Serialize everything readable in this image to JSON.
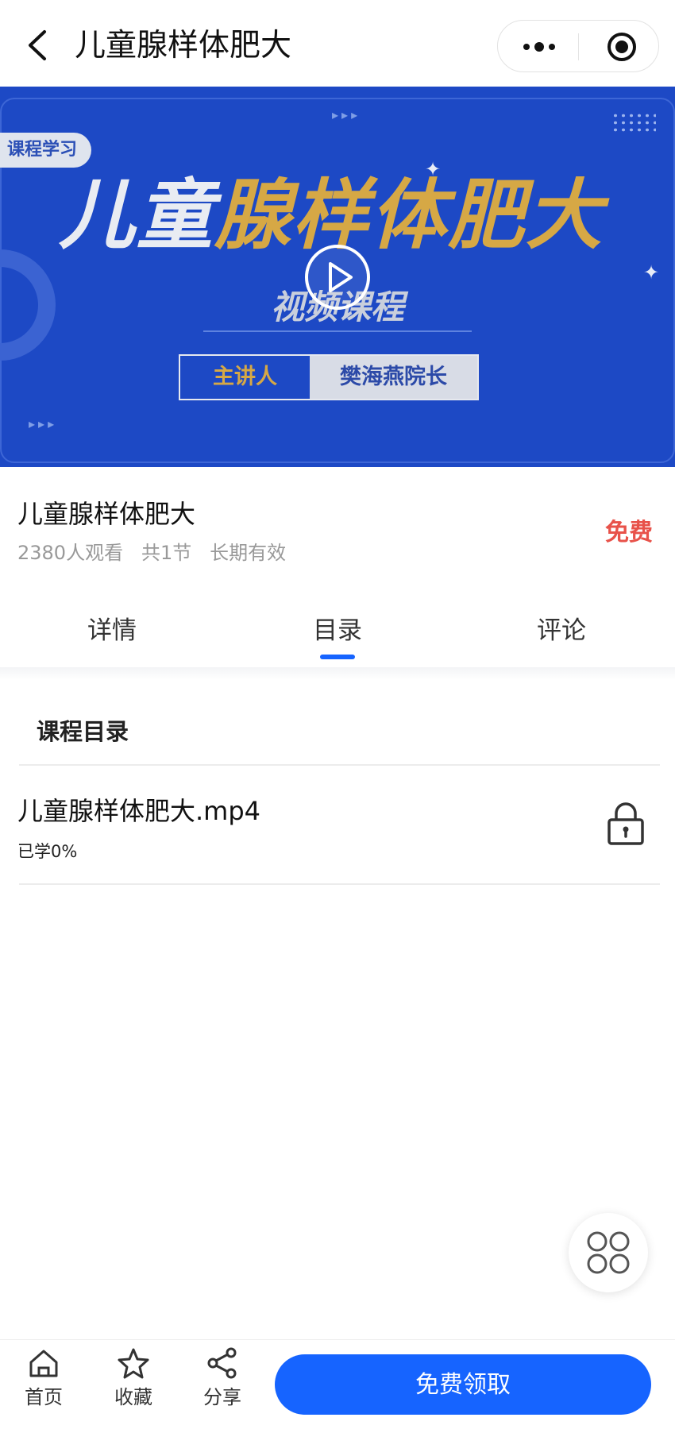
{
  "nav": {
    "title": "儿童腺样体肥大",
    "back_icon": "chevron-left-icon",
    "more_icon": "more-dots-icon",
    "close_icon": "target-circle-icon"
  },
  "banner": {
    "tag": "课程学习",
    "title_white": "儿童",
    "title_gold": "腺样体肥大",
    "subtitle": "视频课程",
    "lecturer_label": "主讲人",
    "lecturer_name": "樊海燕院长",
    "play_icon": "play-circle-icon",
    "colors": {
      "bg": "#1d49c5",
      "gold": "#d6a845"
    }
  },
  "course": {
    "title": "儿童腺样体肥大",
    "views": "2380人观看",
    "sections": "共1节",
    "validity": "长期有效",
    "price": "免费"
  },
  "tabs": {
    "items": [
      "详情",
      "目录",
      "评论"
    ],
    "active": "目录",
    "accent": "#1664ff"
  },
  "catalog": {
    "title": "课程目录",
    "lessons": [
      {
        "name": "儿童腺样体肥大.mp4",
        "progress": "已学0%",
        "icon": "lock-icon"
      }
    ]
  },
  "floating": {
    "icon": "grid-menu-icon"
  },
  "bottom_bar": {
    "home": "首页",
    "favorite": "收藏",
    "share": "分享",
    "cta": "免费领取"
  }
}
